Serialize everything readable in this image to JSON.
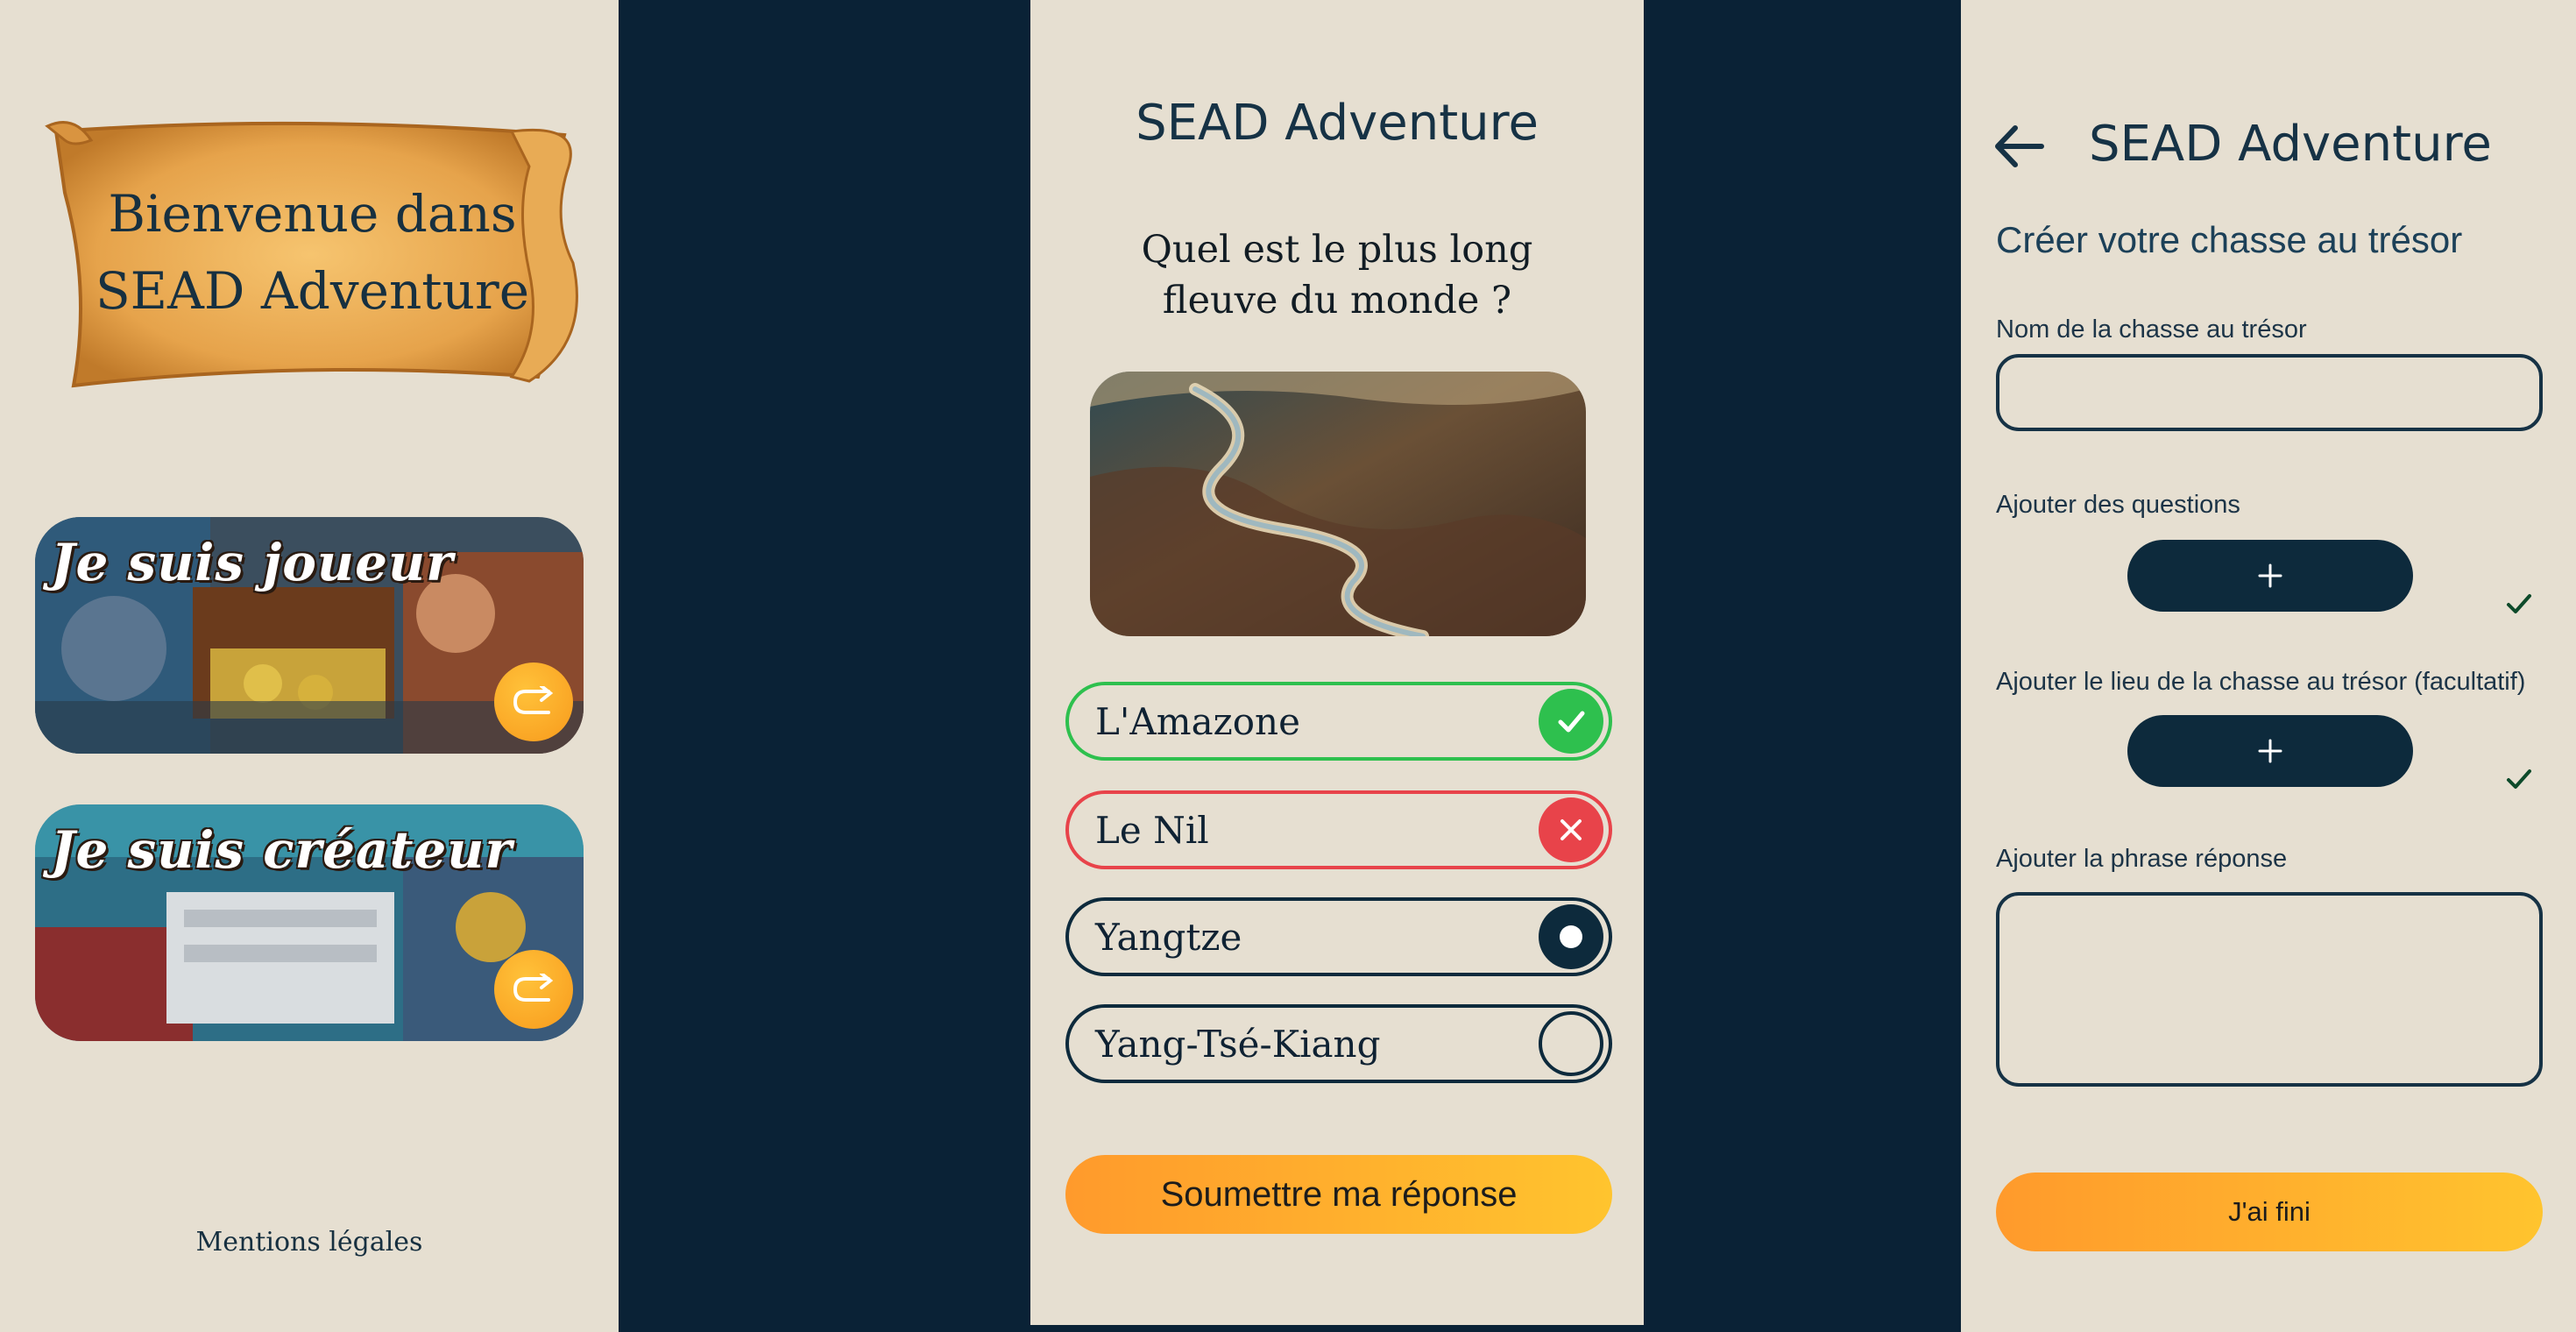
{
  "home": {
    "welcome_line1": "Bienvenue dans",
    "welcome_line2": "SEAD Adventure",
    "player_card": {
      "label": "Je suis joueur",
      "icon": "arrow-right-icon"
    },
    "creator_card": {
      "label": "Je suis créateur",
      "icon": "arrow-right-icon"
    },
    "legal_link": "Mentions légales"
  },
  "quiz": {
    "app_title": "SEAD Adventure",
    "question": "Quel est le plus long fleuve du monde ?",
    "image": "river-aerial-image",
    "answers": [
      {
        "label": "L'Amazone",
        "state": "correct",
        "icon": "check-icon",
        "color": "#2ec04e"
      },
      {
        "label": "Le Nil",
        "state": "wrong",
        "icon": "close-icon",
        "color": "#e8434a"
      },
      {
        "label": "Yangtze",
        "state": "selected",
        "icon": "radio-selected-icon",
        "color": "#0d2a3c"
      },
      {
        "label": "Yang-Tsé-Kiang",
        "state": "unselected",
        "icon": "radio-empty-icon",
        "color": "#0d2a3c"
      }
    ],
    "submit_label": "Soumettre ma réponse"
  },
  "create": {
    "app_title": "SEAD Adventure",
    "subtitle": "Créer votre chasse au trésor",
    "name_label": "Nom de la chasse au trésor",
    "name_value": "",
    "questions_label": "Ajouter des questions",
    "questions_button": "+",
    "location_label": "Ajouter le lieu de la chasse au trésor (facultatif)",
    "location_button": "+",
    "answer_label": "Ajouter la phrase réponse",
    "answer_value": "",
    "done_label": "J'ai fini"
  },
  "colors": {
    "background": "#0a2236",
    "screen": "#e6dfd1",
    "primary": "#0d2a3c",
    "accent_start": "#ff9a2c",
    "accent_end": "#ffc42e",
    "correct": "#2ec04e",
    "wrong": "#e8434a"
  }
}
